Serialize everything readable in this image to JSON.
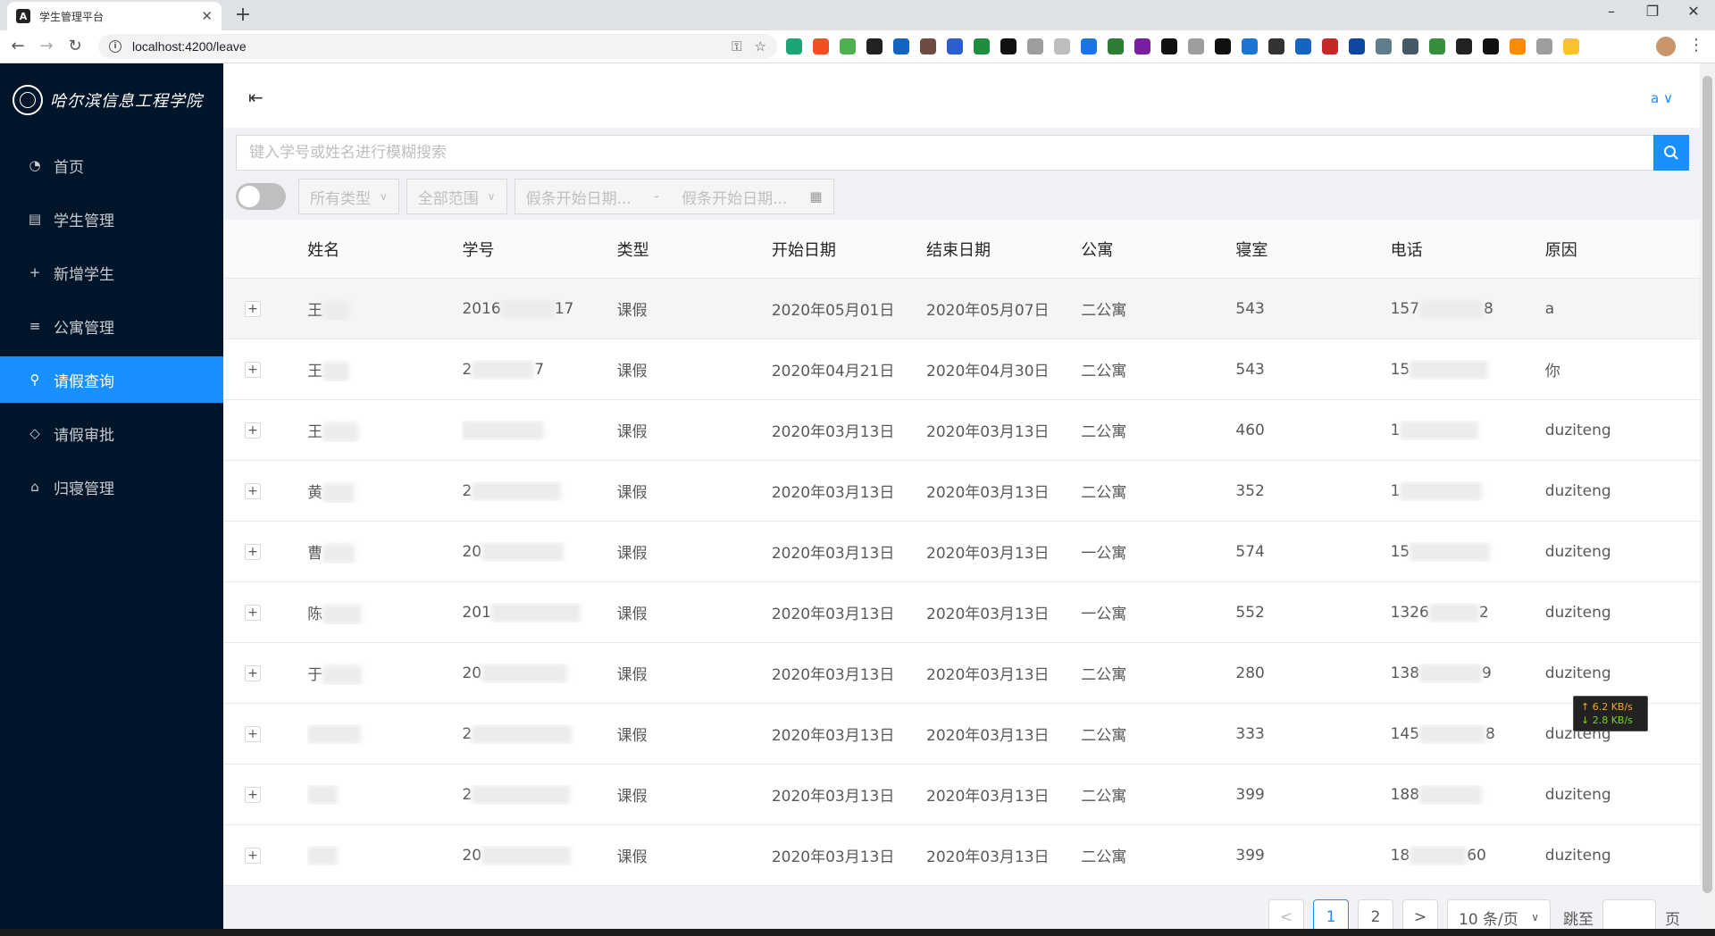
{
  "browser": {
    "tab_title": "学生管理平台",
    "tab_favicon": "A",
    "url": "localhost:4200/leave",
    "extension_colors": [
      "#1da57a",
      "#f25022",
      "#4caf50",
      "#222222",
      "#1565c0",
      "#6d4c41",
      "#2b5fce",
      "#1e8e3e",
      "#111111",
      "#9e9e9e",
      "#bdbdbd",
      "#1a73e8",
      "#2e7d32",
      "#7b1fa2",
      "#111111",
      "#9e9e9e",
      "#111111",
      "#1976d2",
      "#333333",
      "#1565c0",
      "#c62828",
      "#0d47a1",
      "#607d8b",
      "#455a64",
      "#388e3c",
      "#222222",
      "#111111",
      "#fb8c00",
      "#9e9e9e",
      "#fbc02d"
    ]
  },
  "sidebar": {
    "logo_text": "哈尔滨信息工程学院",
    "items": [
      {
        "label": "首页",
        "icon": "pie-chart-icon",
        "glyph": "◔",
        "active": false
      },
      {
        "label": "学生管理",
        "icon": "profile-icon",
        "glyph": "▤",
        "active": false
      },
      {
        "label": "新增学生",
        "icon": "plus-icon",
        "glyph": "+",
        "active": false
      },
      {
        "label": "公寓管理",
        "icon": "bars-icon",
        "glyph": "≡",
        "active": false
      },
      {
        "label": "请假查询",
        "icon": "search-icon",
        "glyph": "⚲",
        "active": true
      },
      {
        "label": "请假审批",
        "icon": "tag-icon",
        "glyph": "◇",
        "active": false
      },
      {
        "label": "归寝管理",
        "icon": "home-icon",
        "glyph": "⌂",
        "active": false
      }
    ]
  },
  "header": {
    "fold_icon": "menu-fold-icon",
    "user_label": "a",
    "user_caret": "∨"
  },
  "search": {
    "placeholder": "键入学号或姓名进行模糊搜索"
  },
  "filters": {
    "toggle_on": false,
    "type_select": "所有类型",
    "scope_select": "全部范围",
    "start_placeholder": "假条开始日期...",
    "range_separator": "-",
    "end_placeholder": "假条开始日期..."
  },
  "table": {
    "columns": [
      "姓名",
      "学号",
      "类型",
      "开始日期",
      "结束日期",
      "公寓",
      "寝室",
      "电话",
      "原因"
    ],
    "rows": [
      {
        "name": "王",
        "name_blur": 30,
        "sid_a": "2016",
        "sid_blur": 60,
        "sid_b": "17",
        "type": "课假",
        "start": "2020年05月01日",
        "end": "2020年05月07日",
        "apt": "二公寓",
        "room": "543",
        "phone_a": "157",
        "phone_blur": 72,
        "phone_b": "8",
        "reason": "a",
        "highlight": true
      },
      {
        "name": "王",
        "name_blur": 30,
        "sid_a": "2",
        "sid_blur": 70,
        "sid_b": "7",
        "type": "课假",
        "start": "2020年04月21日",
        "end": "2020年04月30日",
        "apt": "二公寓",
        "room": "543",
        "phone_a": "15",
        "phone_blur": 88,
        "phone_b": "",
        "reason": "你",
        "highlight": false
      },
      {
        "name": "王",
        "name_blur": 40,
        "sid_a": "",
        "sid_blur": 92,
        "sid_b": "",
        "type": "课假",
        "start": "2020年03月13日",
        "end": "2020年03月13日",
        "apt": "二公寓",
        "room": "460",
        "phone_a": "1",
        "phone_blur": 88,
        "phone_b": "",
        "reason": "duziteng",
        "highlight": false
      },
      {
        "name": "黄",
        "name_blur": 36,
        "sid_a": "2",
        "sid_blur": 100,
        "sid_b": "",
        "type": "课假",
        "start": "2020年03月13日",
        "end": "2020年03月13日",
        "apt": "二公寓",
        "room": "352",
        "phone_a": "1",
        "phone_blur": 92,
        "phone_b": "",
        "reason": "duziteng",
        "highlight": false
      },
      {
        "name": "曹",
        "name_blur": 36,
        "sid_a": "20",
        "sid_blur": 92,
        "sid_b": "",
        "type": "课假",
        "start": "2020年03月13日",
        "end": "2020年03月13日",
        "apt": "一公寓",
        "room": "574",
        "phone_a": "15",
        "phone_blur": 90,
        "phone_b": "",
        "reason": "duziteng",
        "highlight": false
      },
      {
        "name": "陈",
        "name_blur": 44,
        "sid_a": "201",
        "sid_blur": 100,
        "sid_b": "",
        "type": "课假",
        "start": "2020年03月13日",
        "end": "2020年03月13日",
        "apt": "一公寓",
        "room": "552",
        "phone_a": "1326",
        "phone_blur": 56,
        "phone_b": "2",
        "reason": "duziteng",
        "highlight": false
      },
      {
        "name": "于",
        "name_blur": 44,
        "sid_a": "20",
        "sid_blur": 96,
        "sid_b": "",
        "type": "课假",
        "start": "2020年03月13日",
        "end": "2020年03月13日",
        "apt": "二公寓",
        "room": "280",
        "phone_a": "138",
        "phone_blur": 70,
        "phone_b": "9",
        "reason": "duziteng",
        "highlight": false
      },
      {
        "name": "",
        "name_blur": 60,
        "sid_a": "2",
        "sid_blur": 112,
        "sid_b": "",
        "type": "课假",
        "start": "2020年03月13日",
        "end": "2020年03月13日",
        "apt": "二公寓",
        "room": "333",
        "phone_a": "145",
        "phone_blur": 74,
        "phone_b": "8",
        "reason": "duziteng",
        "highlight": false
      },
      {
        "name": "",
        "name_blur": 34,
        "sid_a": "2",
        "sid_blur": 110,
        "sid_b": "",
        "type": "课假",
        "start": "2020年03月13日",
        "end": "2020年03月13日",
        "apt": "二公寓",
        "room": "399",
        "phone_a": "188",
        "phone_blur": 70,
        "phone_b": "",
        "reason": "duziteng",
        "highlight": false
      },
      {
        "name": "",
        "name_blur": 34,
        "sid_a": "20",
        "sid_blur": 100,
        "sid_b": "",
        "type": "课假",
        "start": "2020年03月13日",
        "end": "2020年03月13日",
        "apt": "二公寓",
        "room": "399",
        "phone_a": "18",
        "phone_blur": 64,
        "phone_b": "60",
        "reason": "duziteng",
        "highlight": false
      }
    ]
  },
  "pagination": {
    "prev": "<",
    "pages": [
      "1",
      "2"
    ],
    "current": "1",
    "next": ">",
    "page_size": "10 条/页",
    "jump_label": "跳至",
    "page_suffix": "页"
  },
  "overlay": {
    "speed_up": "↑ 6.2 KB/s",
    "speed_down": "↓ 2.8 KB/s"
  }
}
